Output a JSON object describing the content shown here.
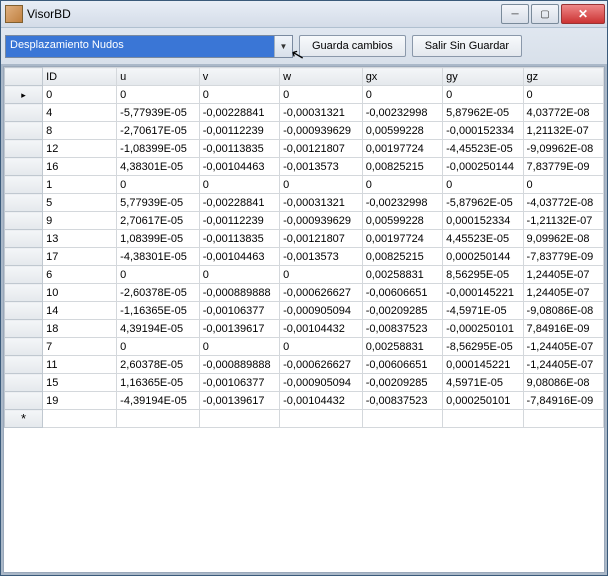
{
  "window": {
    "title": "VisorBD"
  },
  "toolbar": {
    "combo_value": "Desplazamiento Nudos",
    "save_label": "Guarda cambios",
    "exit_label": "Salir Sin Guardar"
  },
  "grid": {
    "columns": [
      "ID",
      "u",
      "v",
      "w",
      "gx",
      "gy",
      "gz"
    ],
    "rows": [
      {
        "ID": "0",
        "u": "0",
        "v": "0",
        "w": "0",
        "gx": "0",
        "gy": "0",
        "gz": "0"
      },
      {
        "ID": "4",
        "u": "-5,77939E-05",
        "v": "-0,00228841",
        "w": "-0,00031321",
        "gx": "-0,00232998",
        "gy": "5,87962E-05",
        "gz": "4,03772E-08"
      },
      {
        "ID": "8",
        "u": "-2,70617E-05",
        "v": "-0,00112239",
        "w": "-0,000939629",
        "gx": "0,00599228",
        "gy": "-0,000152334",
        "gz": "1,21132E-07"
      },
      {
        "ID": "12",
        "u": "-1,08399E-05",
        "v": "-0,00113835",
        "w": "-0,00121807",
        "gx": "0,00197724",
        "gy": "-4,45523E-05",
        "gz": "-9,09962E-08"
      },
      {
        "ID": "16",
        "u": "4,38301E-05",
        "v": "-0,00104463",
        "w": "-0,0013573",
        "gx": "0,00825215",
        "gy": "-0,000250144",
        "gz": "7,83779E-09"
      },
      {
        "ID": "1",
        "u": "0",
        "v": "0",
        "w": "0",
        "gx": "0",
        "gy": "0",
        "gz": "0"
      },
      {
        "ID": "5",
        "u": "5,77939E-05",
        "v": "-0,00228841",
        "w": "-0,00031321",
        "gx": "-0,00232998",
        "gy": "-5,87962E-05",
        "gz": "-4,03772E-08"
      },
      {
        "ID": "9",
        "u": "2,70617E-05",
        "v": "-0,00112239",
        "w": "-0,000939629",
        "gx": "0,00599228",
        "gy": "0,000152334",
        "gz": "-1,21132E-07"
      },
      {
        "ID": "13",
        "u": "1,08399E-05",
        "v": "-0,00113835",
        "w": "-0,00121807",
        "gx": "0,00197724",
        "gy": "4,45523E-05",
        "gz": "9,09962E-08"
      },
      {
        "ID": "17",
        "u": "-4,38301E-05",
        "v": "-0,00104463",
        "w": "-0,0013573",
        "gx": "0,00825215",
        "gy": "0,000250144",
        "gz": "-7,83779E-09"
      },
      {
        "ID": "6",
        "u": "0",
        "v": "0",
        "w": "0",
        "gx": "0,00258831",
        "gy": "8,56295E-05",
        "gz": "1,24405E-07"
      },
      {
        "ID": "10",
        "u": "-2,60378E-05",
        "v": "-0,000889888",
        "w": "-0,000626627",
        "gx": "-0,00606651",
        "gy": "-0,000145221",
        "gz": "1,24405E-07"
      },
      {
        "ID": "14",
        "u": "-1,16365E-05",
        "v": "-0,00106377",
        "w": "-0,000905094",
        "gx": "-0,00209285",
        "gy": "-4,5971E-05",
        "gz": "-9,08086E-08"
      },
      {
        "ID": "18",
        "u": "4,39194E-05",
        "v": "-0,00139617",
        "w": "-0,00104432",
        "gx": "-0,00837523",
        "gy": "-0,000250101",
        "gz": "7,84916E-09"
      },
      {
        "ID": "7",
        "u": "0",
        "v": "0",
        "w": "0",
        "gx": "0,00258831",
        "gy": "-8,56295E-05",
        "gz": "-1,24405E-07"
      },
      {
        "ID": "11",
        "u": "2,60378E-05",
        "v": "-0,000889888",
        "w": "-0,000626627",
        "gx": "-0,00606651",
        "gy": "0,000145221",
        "gz": "-1,24405E-07"
      },
      {
        "ID": "15",
        "u": "1,16365E-05",
        "v": "-0,00106377",
        "w": "-0,000905094",
        "gx": "-0,00209285",
        "gy": "4,5971E-05",
        "gz": "9,08086E-08"
      },
      {
        "ID": "19",
        "u": "-4,39194E-05",
        "v": "-0,00139617",
        "w": "-0,00104432",
        "gx": "-0,00837523",
        "gy": "0,000250101",
        "gz": "-7,84916E-09"
      }
    ]
  }
}
